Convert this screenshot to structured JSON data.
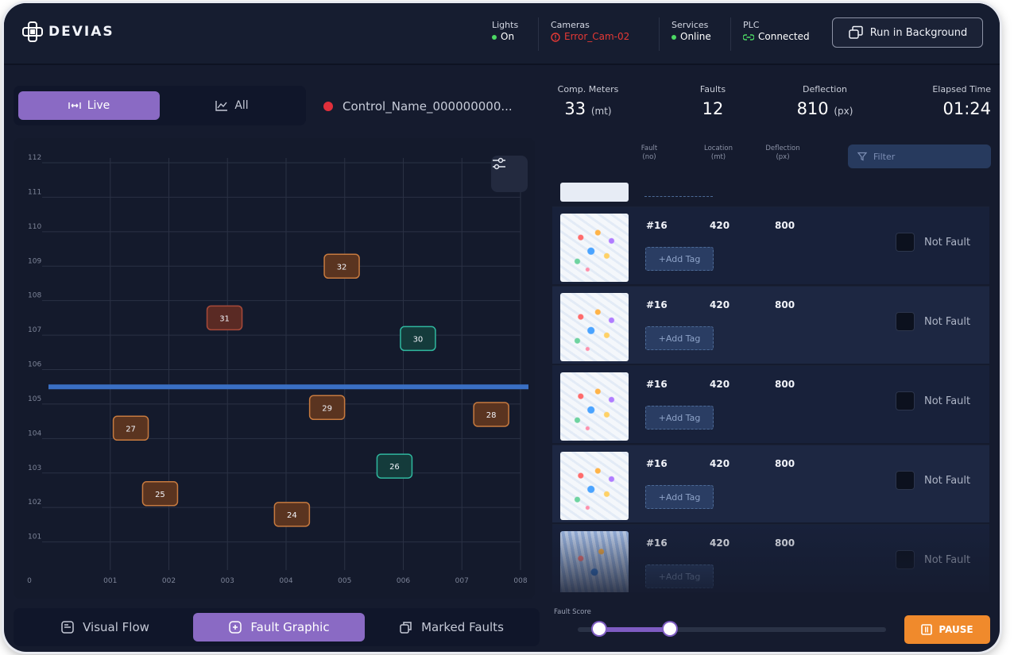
{
  "app": {
    "logo_text": "DEVIAS"
  },
  "header": {
    "lights": {
      "label": "Lights",
      "value": "On",
      "color": "#4cd964"
    },
    "cameras": {
      "label": "Cameras",
      "value": "Error_Cam-02",
      "color": "#e53935"
    },
    "services": {
      "label": "Services",
      "value": "Online",
      "color": "#4cd964"
    },
    "plc": {
      "label": "PLC",
      "value": "Connected",
      "color": "#4cd964"
    },
    "run_bg_label": "Run in Background"
  },
  "view_toggle": {
    "live": "Live",
    "all": "All"
  },
  "control_name": "Control_Name_000000000...",
  "stats": {
    "comp_meters": {
      "label": "Comp. Meters",
      "value": "33",
      "unit": "(mt)"
    },
    "faults": {
      "label": "Faults",
      "value": "12"
    },
    "deflection": {
      "label": "Deflection",
      "value": "810",
      "unit": "(px)"
    },
    "elapsed": {
      "label": "Elapsed Time",
      "value": "01:24"
    }
  },
  "list_header": {
    "fault": "Fault",
    "fault_unit": "(no)",
    "location": "Location",
    "location_unit": "(mt)",
    "deflection": "Deflection",
    "deflection_unit": "(px)",
    "filter_placeholder": "Filter"
  },
  "fault_rows": [
    {
      "id": "#16",
      "location": "420",
      "deflection": "800",
      "tag": "+Add Tag",
      "not_fault": "Not Fault"
    },
    {
      "id": "#16",
      "location": "420",
      "deflection": "800",
      "tag": "+Add Tag",
      "not_fault": "Not Fault"
    },
    {
      "id": "#16",
      "location": "420",
      "deflection": "800",
      "tag": "+Add Tag",
      "not_fault": "Not Fault"
    },
    {
      "id": "#16",
      "location": "420",
      "deflection": "800",
      "tag": "+Add Tag",
      "not_fault": "Not Fault"
    },
    {
      "id": "#16",
      "location": "420",
      "deflection": "800",
      "tag": "+Add Tag",
      "not_fault": "Not Fault"
    }
  ],
  "bottom_tabs": {
    "visual_flow": "Visual Flow",
    "fault_graphic": "Fault Graphic",
    "marked_faults": "Marked Faults"
  },
  "fault_score": {
    "label": "Fault Score",
    "low": 0.07,
    "high": 0.3
  },
  "pause_label": "PAUSE",
  "chart_data": {
    "type": "scatter",
    "x_ticks": [
      "0",
      "001",
      "002",
      "003",
      "004",
      "005",
      "006",
      "007",
      "008"
    ],
    "y_ticks": [
      "101",
      "102",
      "103",
      "104",
      "105",
      "106",
      "107",
      "108",
      "109",
      "110",
      "111",
      "112"
    ],
    "xlim": [
      0,
      8
    ],
    "ylim": [
      100,
      112
    ],
    "reference_line_y": 105.5,
    "grid": true,
    "points": [
      {
        "label": "32",
        "x": 4.95,
        "y": 109.0,
        "kind": "orange"
      },
      {
        "label": "31",
        "x": 2.95,
        "y": 107.5,
        "kind": "red"
      },
      {
        "label": "30",
        "x": 6.25,
        "y": 106.9,
        "kind": "green"
      },
      {
        "label": "29",
        "x": 4.7,
        "y": 104.9,
        "kind": "orange"
      },
      {
        "label": "28",
        "x": 7.5,
        "y": 104.7,
        "kind": "orange"
      },
      {
        "label": "27",
        "x": 1.35,
        "y": 104.3,
        "kind": "orange"
      },
      {
        "label": "26",
        "x": 5.85,
        "y": 103.2,
        "kind": "green"
      },
      {
        "label": "25",
        "x": 1.85,
        "y": 102.4,
        "kind": "orange"
      },
      {
        "label": "24",
        "x": 4.1,
        "y": 101.8,
        "kind": "orange"
      }
    ],
    "colors": {
      "orange": {
        "fill": "#5a3420",
        "stroke": "#c77a3f"
      },
      "red": {
        "fill": "#5a2a24",
        "stroke": "#a84a3a"
      },
      "green": {
        "fill": "#143b3b",
        "stroke": "#2fb89f"
      },
      "reference": "#3a6fc4"
    }
  }
}
